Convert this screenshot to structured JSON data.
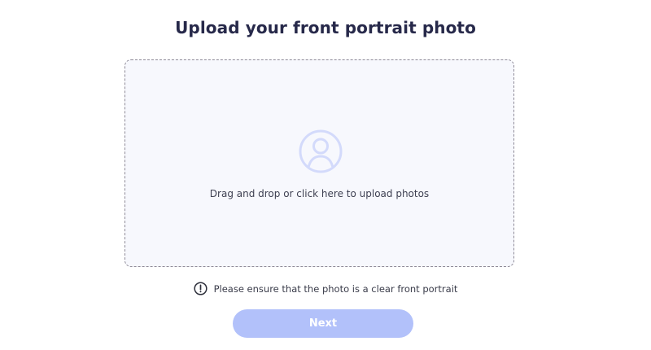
{
  "header": {
    "title": "Upload your front portrait photo"
  },
  "dropzone": {
    "icon": "user-avatar-icon",
    "instruction": "Drag and drop or click here to upload photos"
  },
  "notice": {
    "icon": "exclamation-circle-icon",
    "text": "Please ensure that the photo is a clear front portrait"
  },
  "actions": {
    "next_label": "Next",
    "next_state": "disabled"
  },
  "colors": {
    "title": "#27294a",
    "dropzone_bg": "#f7f8fd",
    "dropzone_border": "#8e8a97",
    "icon": "#d3dafb",
    "button_bg": "#b2c1fa"
  }
}
